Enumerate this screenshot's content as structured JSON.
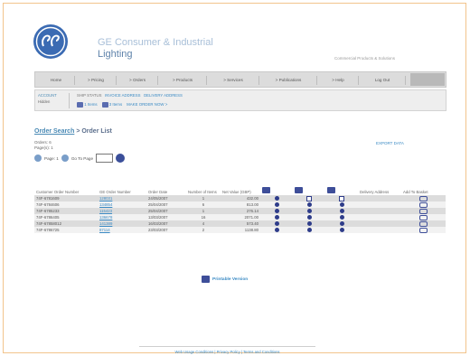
{
  "brand": {
    "name_line1": "GE Consumer & Industrial",
    "name_line2": "Lighting",
    "tagline": "Commercial Products & Solutions",
    "colors": {
      "ge_blue": "#3b6bb3",
      "link": "#3a8ac4",
      "nav_bg": "#dcdcdc",
      "frame": "#f2c48c"
    }
  },
  "nav": {
    "items": [
      "Home",
      "> Pricing",
      "> Orders",
      "> Products",
      "> Services",
      "> Publications",
      "> Help",
      "Log Out"
    ]
  },
  "subnav": {
    "account_label": "ACCOUNT",
    "account_value": "Hidden",
    "ship_label": "SHIP STATUS",
    "ship_link1": "INVOICE ADDRESS",
    "ship_link2": "DELIVERY ADDRESS",
    "cart_label": "1 Items",
    "items_label": "3 Items",
    "order_link": "MAKE ORDER NOW >"
  },
  "page": {
    "breadcrumb": "Order Search",
    "separator": ">",
    "title": "Order List",
    "orders_count": "Orders: 6",
    "pages_count": "Page(s): 1",
    "export_label": "EXPORT DATA",
    "pager_page": "Page: 1",
    "pager_goto": "Go To Page"
  },
  "table": {
    "headers": [
      "Customer Order Number",
      "GE Order Number",
      "Order Date",
      "Number of Items",
      "Net Value (GBP)",
      "",
      "",
      "",
      "Delivery Address",
      "Add To Basket"
    ],
    "rows": [
      {
        "cust": "74F-6781609",
        "ge": "128031",
        "date": "24/05/2007",
        "items": "1",
        "value": "432.00",
        "c1": "dot",
        "c2": "hollow",
        "c3": "hollow"
      },
      {
        "cust": "74F-6784606",
        "ge": "134854",
        "date": "25/04/2007",
        "items": "6",
        "value": "813.00",
        "c1": "dot",
        "c2": "dot",
        "c3": "dot"
      },
      {
        "cust": "74F-6785233",
        "ge": "115423",
        "date": "25/04/2007",
        "items": "1",
        "value": "276.14",
        "c1": "dot",
        "c2": "dot",
        "c3": "dot"
      },
      {
        "cust": "74F-6786405",
        "ge": "136678",
        "date": "13/03/2007",
        "items": "16",
        "value": "2071.00",
        "c1": "dot",
        "c2": "dot",
        "c3": "dot"
      },
      {
        "cust": "74F-67858012",
        "ge": "141389",
        "date": "16/03/2007",
        "items": "4",
        "value": "573.40",
        "c1": "dot",
        "c2": "dot",
        "c3": "dot"
      },
      {
        "cust": "74F-6786725",
        "ge": "87114",
        "date": "23/03/2007",
        "items": "2",
        "value": "1138.80",
        "c1": "dot",
        "c2": "dot",
        "c3": "dot"
      }
    ]
  },
  "printable": {
    "label": "Printable Version"
  },
  "footer": {
    "text": "Web Usage Conditions | Privacy Policy | Terms and Conditions"
  }
}
